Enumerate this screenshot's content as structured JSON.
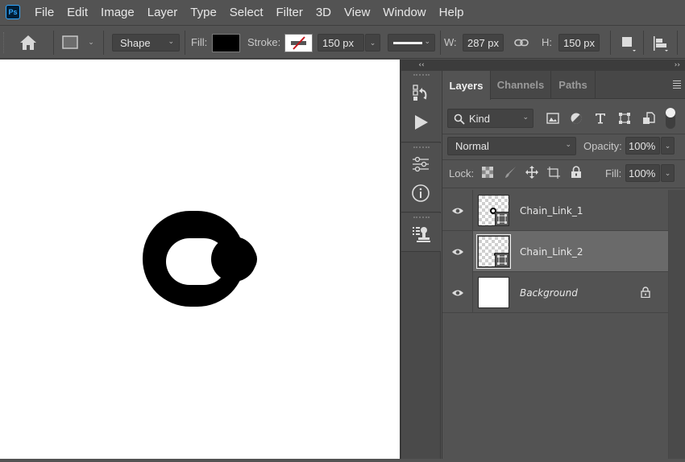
{
  "app": {
    "logo_text": "Ps"
  },
  "menu": [
    "File",
    "Edit",
    "Image",
    "Layer",
    "Type",
    "Select",
    "Filter",
    "3D",
    "View",
    "Window",
    "Help"
  ],
  "options": {
    "home_icon": "home-icon",
    "tool_mode": "Shape",
    "fill_label": "Fill:",
    "fill_color": "#000000",
    "stroke_label": "Stroke:",
    "stroke_color": "none",
    "stroke_width": "150 px",
    "width_label": "W:",
    "width_value": "287 px",
    "height_label": "H:",
    "height_value": "150 px",
    "link_icon": "link-icon",
    "path_ops_icon": "path-operations-icon",
    "path_align_icon": "path-alignment-icon"
  },
  "panel_collapse": {
    "left": "‹‹",
    "right": "››"
  },
  "strip_icons": [
    "history-icon",
    "actions-play-icon",
    "adjustments-icon",
    "info-icon",
    "clone-source-icon"
  ],
  "layers_panel": {
    "tabs": [
      {
        "label": "Layers",
        "active": true
      },
      {
        "label": "Channels",
        "active": false
      },
      {
        "label": "Paths",
        "active": false
      }
    ],
    "filter": {
      "label": "Kind",
      "icons": [
        "image-filter-icon",
        "adjustment-filter-icon",
        "type-filter-icon",
        "shape-filter-icon",
        "smart-object-filter-icon"
      ]
    },
    "blend_mode": "Normal",
    "opacity_label": "Opacity:",
    "opacity_value": "100%",
    "lock_label": "Lock:",
    "lock_icons": [
      "lock-transparent-icon",
      "lock-image-icon",
      "lock-position-icon",
      "lock-artboard-icon",
      "lock-all-icon"
    ],
    "fill_label": "Fill:",
    "fill_value": "100%",
    "layers": [
      {
        "name": "Chain_Link_1",
        "visible": true,
        "selected": false,
        "type": "shape",
        "locked": false
      },
      {
        "name": "Chain_Link_2",
        "visible": true,
        "selected": true,
        "type": "shape",
        "locked": false
      },
      {
        "name": "Background",
        "visible": true,
        "selected": false,
        "type": "background",
        "locked": true
      }
    ]
  }
}
